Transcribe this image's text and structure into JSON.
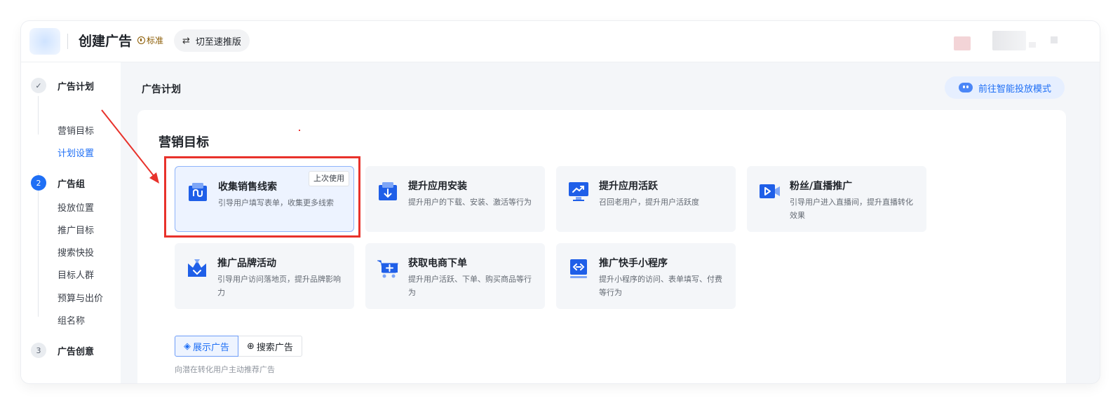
{
  "header": {
    "title": "创建广告",
    "badge": "标准",
    "switch_label": "切至速推版"
  },
  "sidebar": {
    "steps": [
      {
        "index": "✓",
        "label": "广告计划",
        "subs": [
          "营销目标",
          "计划设置"
        ]
      },
      {
        "index": "2",
        "label": "广告组",
        "subs": [
          "投放位置",
          "推广目标",
          "搜索快投",
          "目标人群",
          "预算与出价",
          "组名称"
        ]
      },
      {
        "index": "3",
        "label": "广告创意",
        "subs": []
      }
    ]
  },
  "main": {
    "section_title": "广告计划",
    "smart_mode_label": "前往智能投放模式",
    "panel_title": "营销目标",
    "cards": [
      {
        "title": "收集销售线索",
        "desc": "引导用户填写表单，收集更多线索",
        "tag": "上次使用",
        "icon": "form-icon",
        "selected": true
      },
      {
        "title": "提升应用安装",
        "desc": "提升用户的下载、安装、激活等行为",
        "icon": "download-icon"
      },
      {
        "title": "提升应用活跃",
        "desc": "召回老用户，提升用户活跃度",
        "icon": "trend-monitor-icon"
      },
      {
        "title": "粉丝/直播推广",
        "desc": "引导用户进入直播间，提升直播转化效果",
        "icon": "live-video-icon"
      },
      {
        "title": "推广品牌活动",
        "desc": "引导用户访问落地页，提升品牌影响力",
        "icon": "crown-icon"
      },
      {
        "title": "获取电商下单",
        "desc": "提升用户活跃、下单、购买商品等行为",
        "icon": "cart-icon"
      },
      {
        "title": "推广快手小程序",
        "desc": "提升小程序的访问、表单填写、付费等行为",
        "icon": "mini-program-icon"
      }
    ],
    "ad_types": [
      "展示广告",
      "搜索广告"
    ],
    "ad_type_note": "向潜在转化用户主动推荐广告"
  },
  "colors": {
    "accent": "#1f6ff5",
    "highlight": "#e8322b"
  }
}
